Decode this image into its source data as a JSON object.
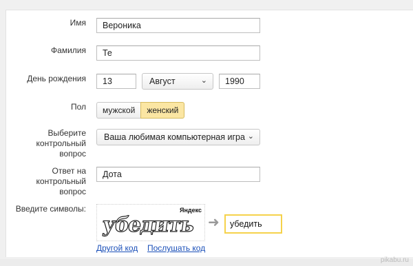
{
  "form": {
    "first_name_label": "Имя",
    "first_name_value": "Вероника",
    "last_name_label": "Фамилия",
    "last_name_value": "Те",
    "birthday_label": "День рождения",
    "birthday_day": "13",
    "birthday_month": "Август",
    "birthday_year": "1990",
    "gender_label": "Пол",
    "gender_options": [
      "мужской",
      "женский"
    ],
    "gender_selected": "женский",
    "question_label_line1": "Выберите",
    "question_label_line2": "контрольный",
    "question_label_line3": "вопрос",
    "question_value": "Ваша любимая компьютерная игра",
    "answer_label_line1": "Ответ на",
    "answer_label_line2": "контрольный",
    "answer_label_line3": "вопрос",
    "answer_value": "Дота",
    "captcha_label": "Введите символы:",
    "captcha_logo": "Яндекс",
    "captcha_image_text": "убедить",
    "captcha_input_value": "убедить",
    "captcha_other_link": "Другой код",
    "captcha_listen_link": "Послушать код"
  },
  "watermark": "pikabu.ru",
  "colors": {
    "selected_bg": "#fbe6a3",
    "focus_border": "#f5d24b",
    "link": "#1a4fb8"
  }
}
